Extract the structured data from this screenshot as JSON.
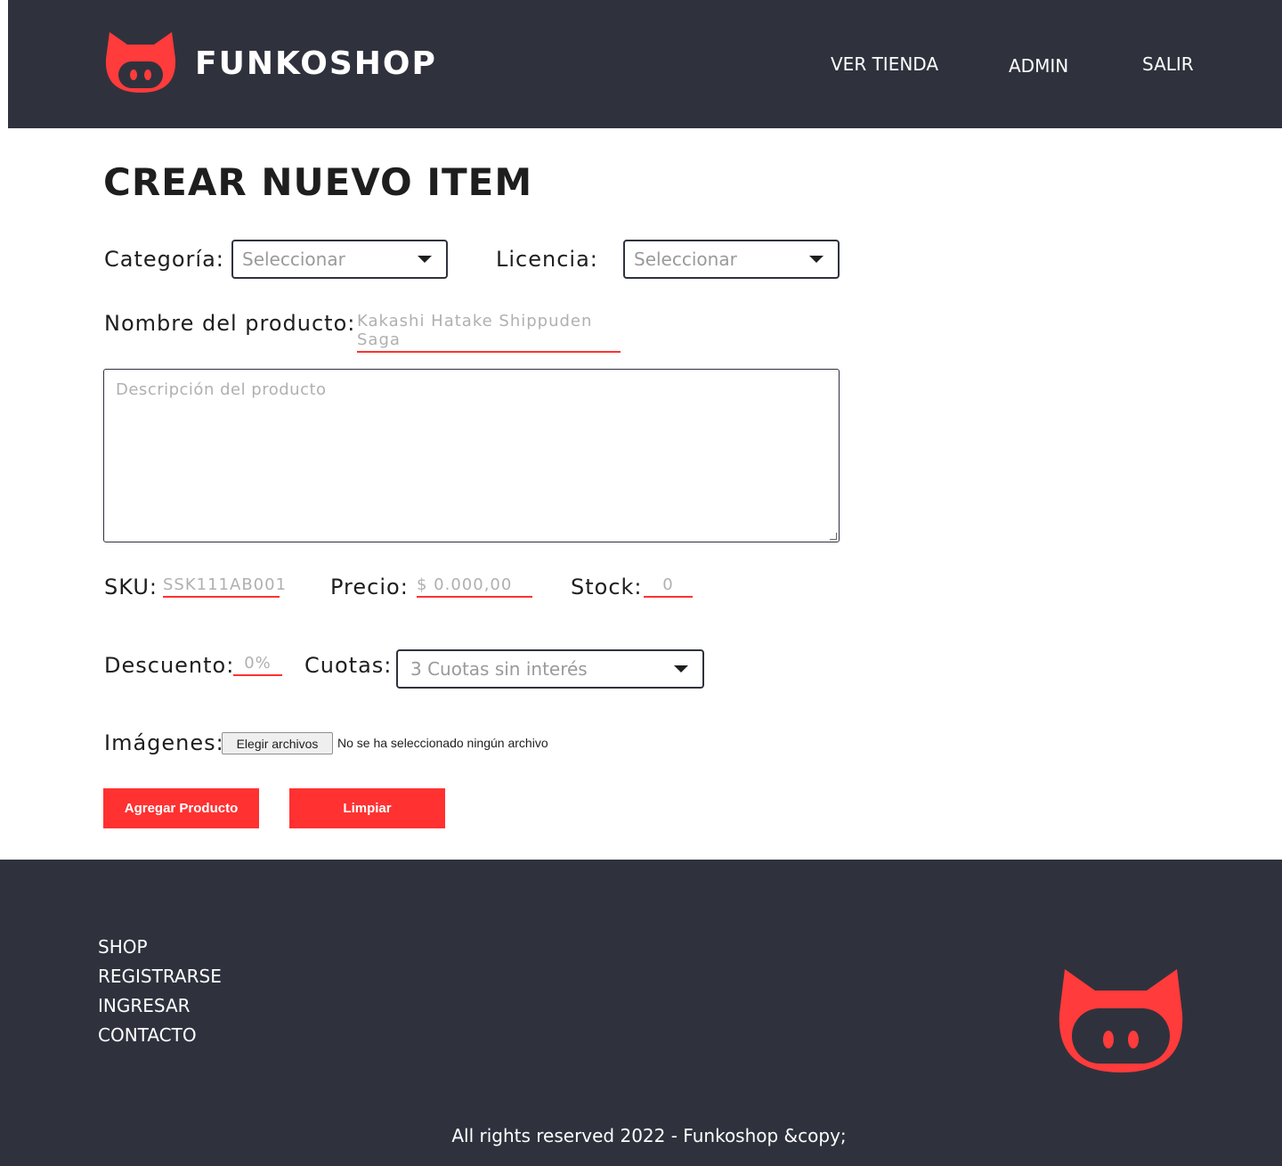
{
  "header": {
    "brand": "FUNKOSHOP",
    "nav": [
      "VER TIENDA",
      "ADMIN",
      "SALIR"
    ]
  },
  "page_title": "CREAR NUEVO ITEM",
  "form": {
    "categoria_label": "Categoría:",
    "categoria_value": "Seleccionar",
    "licencia_label": "Licencia:",
    "licencia_value": "Seleccionar",
    "nombre_label": "Nombre del producto:",
    "nombre_placeholder": "Kakashi Hatake Shippuden Saga",
    "descripcion_placeholder": "Descripción del producto",
    "sku_label": "SKU:",
    "sku_placeholder": "SSK111AB001",
    "precio_label": "Precio:",
    "precio_placeholder": "$ 0.000,00",
    "stock_label": "Stock:",
    "stock_placeholder": "0",
    "descuento_label": "Descuento:",
    "descuento_placeholder": "0%",
    "cuotas_label": "Cuotas:",
    "cuotas_value": "3 Cuotas sin interés",
    "imagenes_label": "Imágenes:",
    "file_button": "Elegir archivos",
    "file_status": "No se ha seleccionado ningún archivo",
    "submit_label": "Agregar Producto",
    "clear_label": "Limpiar"
  },
  "footer": {
    "links": [
      "SHOP",
      "REGISTRARSE",
      "INGRESAR",
      "CONTACTO"
    ],
    "copyright": "All rights reserved 2022 - Funkoshop &copy;"
  },
  "colors": {
    "dark": "#2f323d",
    "accent": "#ff3131"
  },
  "icons": {
    "logo": "funko-cat-head-icon",
    "dropdown": "caret-down-icon"
  }
}
